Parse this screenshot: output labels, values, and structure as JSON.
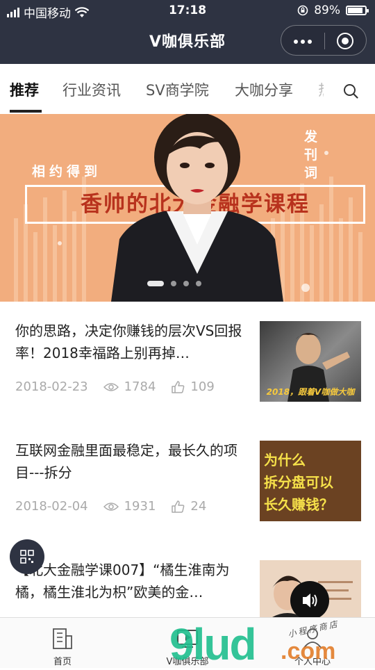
{
  "status_bar": {
    "carrier": "中国移动",
    "time": "17:18",
    "battery_percent": "89%",
    "battery_level": 0.89
  },
  "header": {
    "title": "V咖俱乐部"
  },
  "tabs": [
    {
      "label": "推荐",
      "active": true
    },
    {
      "label": "行业资讯",
      "active": false
    },
    {
      "label": "SV商学院",
      "active": false
    },
    {
      "label": "大咖分享",
      "active": false
    },
    {
      "label": "热",
      "active": false
    }
  ],
  "banner": {
    "subtitle": "相约得到",
    "vertical_text": "发刊词",
    "title": "香帅的北大金融学课程",
    "slide_count": 4,
    "active_slide": 1
  },
  "articles": [
    {
      "title": "你的思路，决定你赚钱的层次VS回报率！2018幸福路上别再掉…",
      "date": "2018-02-23",
      "views": "1784",
      "likes": "109",
      "thumb_caption": "2018，跟着V咖做大咖"
    },
    {
      "title": "互联网金融里面最稳定，最长久的项目---拆分",
      "date": "2018-02-04",
      "views": "1931",
      "likes": "24",
      "thumb_lines": [
        "为什么",
        "拆分盘可以",
        "长久赚钱？"
      ]
    },
    {
      "title": "【北大金融学课007】“橘生淮南为橘，橘生淮北为枳”欧美的金…",
      "date": "",
      "views": "",
      "likes": ""
    }
  ],
  "tabbar": [
    {
      "label": "首页",
      "icon": "building-icon"
    },
    {
      "label": "V咖俱乐部",
      "icon": "video-icon"
    },
    {
      "label": "个人中心",
      "icon": "person-icon"
    }
  ],
  "watermark": {
    "main": "9lud",
    "suffix": ".com",
    "tagline": "小程序商店"
  },
  "colors": {
    "header_bg": "#2e3342",
    "banner_bg": "#f2ad7e",
    "banner_title": "#b8321d",
    "watermark_green": "#1fbf8e",
    "watermark_orange": "#e27d2a"
  }
}
